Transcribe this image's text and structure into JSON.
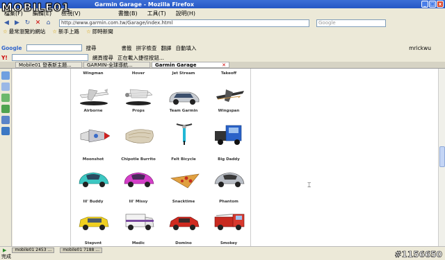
{
  "window": {
    "title": "Garmin Garage - Mozilla Firefox"
  },
  "watermark": {
    "logo": "MOBILE01",
    "id": "#1156650"
  },
  "menubar": [
    "檔案(F)",
    "編輯(E)",
    "檢視(V)",
    "書籤(B)",
    "工具(T)",
    "說明(H)"
  ],
  "navbar": {
    "url": "http://www.garmin.com.tw/Garage/index.html",
    "search_placeholder": "Google"
  },
  "bookmarks": [
    "最常瀏覽的網站",
    "新手上路",
    "即時新聞"
  ],
  "googlebar": {
    "brand": "Google",
    "items": [
      "搜尋",
      "書籤",
      "拼字檢查",
      "翻譯",
      "自動填入"
    ],
    "user": "mrickwu"
  },
  "yahoobar": {
    "brand": "Y!",
    "items": [
      "網頁搜尋",
      "正在載入捷徑按鈕..."
    ]
  },
  "tabs": [
    {
      "label": "Mobile01 發表新主題..."
    },
    {
      "label": "GARMIN-全球導航..."
    },
    {
      "label": "Garmin Garage",
      "close": "✕"
    }
  ],
  "garage": {
    "rows": [
      {
        "labels_above": [
          "Wingman",
          "Hover",
          "Jet Stream",
          "Takeoff"
        ],
        "icons": [
          "plane-white",
          "plane-twin",
          "car-silver",
          "plane-dark"
        ],
        "labels_below": [
          "Airborne",
          "Props",
          "Team Garmin",
          "Wingspan"
        ]
      },
      {
        "icons": [
          "rocket",
          "burrito",
          "bicycle",
          "truck-blue"
        ],
        "labels_below": [
          "Moonshot",
          "Chipotle Burrito",
          "Felt Bicycle",
          "Big Daddy"
        ]
      },
      {
        "icons": [
          "car-teal",
          "car-pink",
          "pizza",
          "car-grey"
        ],
        "labels_below": [
          "lil' Buddy",
          "lil' Missy",
          "Snacktime",
          "Phantom"
        ]
      },
      {
        "icons": [
          "taxi",
          "ambulance",
          "car-red",
          "firetruck"
        ],
        "labels_below": [
          "Stepvnt",
          "Medic",
          "Domino",
          "Smokey"
        ]
      }
    ]
  },
  "statusbar": {
    "tasks": [
      "mobile01 2453 ...",
      "mobile01 7188 ..."
    ],
    "done": "完成"
  }
}
